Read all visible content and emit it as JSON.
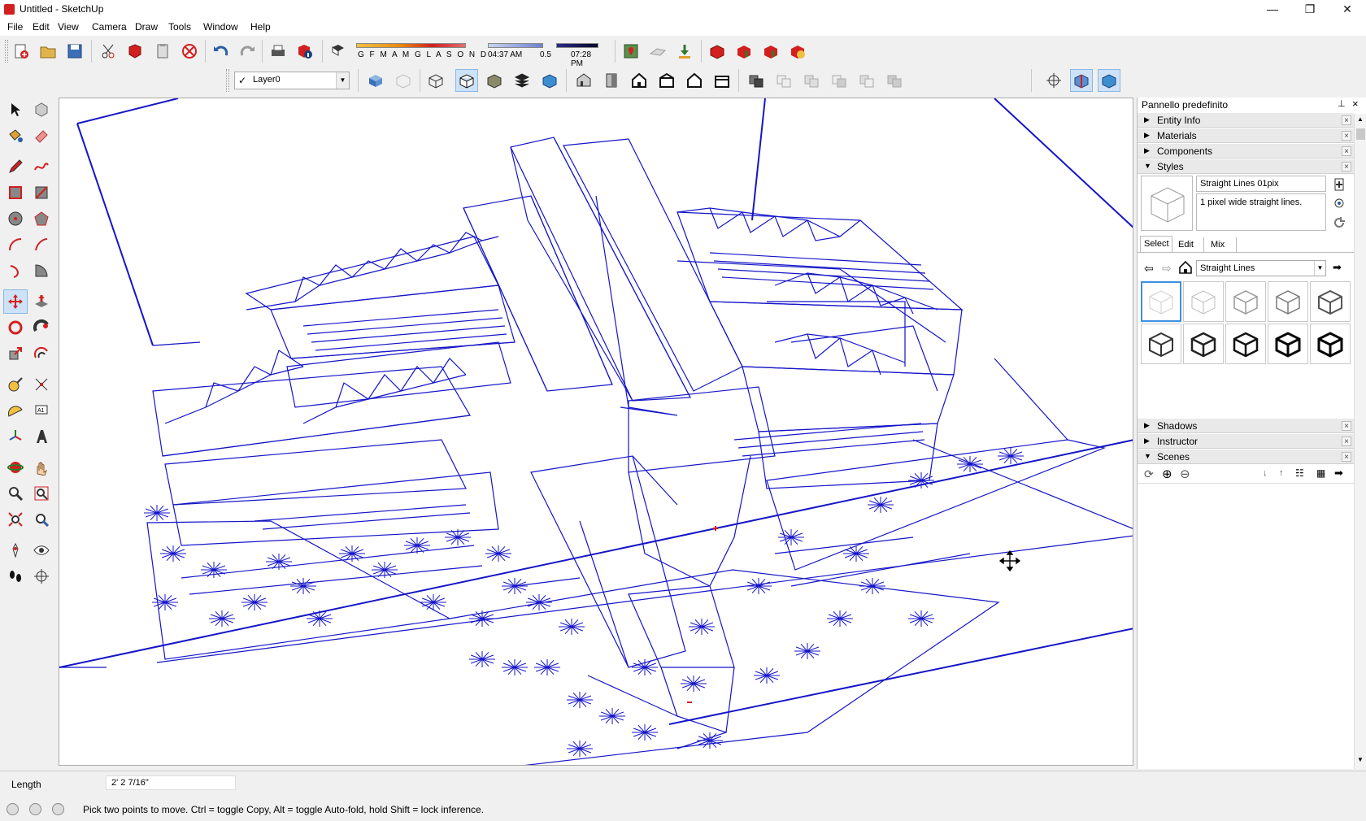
{
  "window": {
    "title": "Untitled - SketchUp",
    "minimize_glyph": "—",
    "restore_glyph": "❐",
    "close_glyph": "✕"
  },
  "menu": [
    "File",
    "Edit",
    "View",
    "Camera",
    "Draw",
    "Tools",
    "Window",
    "Help"
  ],
  "shadow_toolbar": {
    "months": "G F M A M G L A S O N D",
    "time_start": "04:37 AM",
    "time_mid": "0.5",
    "time_end": "07:28 PM"
  },
  "layer": {
    "checkmark": "✓",
    "name": "Layer0"
  },
  "tray": {
    "title": "Pannello predefinito",
    "pin_glyph": "⊥",
    "close_glyph": "×",
    "sections_top": [
      "Entity Info",
      "Materials",
      "Components",
      "Styles"
    ],
    "sections_bottom": [
      "Shadows",
      "Instructor",
      "Scenes"
    ],
    "style": {
      "name": "Straight Lines 01pix",
      "description": "1 pixel wide straight lines.",
      "tabs": [
        "Select",
        "Edit",
        "Mix"
      ],
      "collection": "Straight Lines"
    }
  },
  "measurements": {
    "label": "Length",
    "value": "2' 2 7/16\""
  },
  "status": {
    "hint": "Pick two points to move.  Ctrl = toggle Copy, Alt = toggle Auto-fold, hold Shift = lock inference."
  },
  "colors": {
    "model_lines": "#1515c8",
    "accent_red": "#d21f1f",
    "selection_blue": "#3d8fe0"
  }
}
